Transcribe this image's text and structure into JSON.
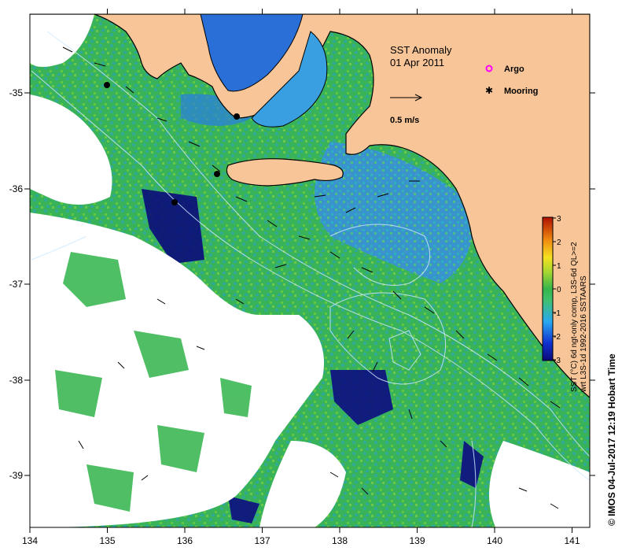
{
  "title": {
    "line1": "SST Anomaly",
    "line2": "01 Apr 2011"
  },
  "legend": {
    "argo_label": "Argo",
    "mooring_label": "Mooring",
    "argo_color": "#ff00ff",
    "mooring_color": "#000000",
    "argo_icon": "circle-marker",
    "mooring_icon": "star-marker"
  },
  "velocity_scale": {
    "label": "0.5 m/s",
    "icon": "arrow-right"
  },
  "axes": {
    "x_ticks": [
      "134",
      "135",
      "136",
      "137",
      "138",
      "139",
      "140",
      "141"
    ],
    "y_ticks": [
      "-35",
      "-36",
      "-37",
      "-38",
      "-39"
    ],
    "x_range": [
      134,
      141.3
    ],
    "y_range": [
      -39.45,
      -34.1
    ]
  },
  "colorbar": {
    "ticks": [
      "3",
      "2",
      "1",
      "0",
      "-1",
      "-2",
      "-3"
    ],
    "range": [
      -3,
      3
    ],
    "caption_line1": "SST (°C) 6d ngt-only comp, L3S-6d QL>=2",
    "caption_line2": "wrt L3S-1d 1992-2016 SSTAARS"
  },
  "footer": {
    "credit": "© IMOS 04-Jul-2017 12:19 Hobart Time"
  },
  "colors": {
    "land": "#f7c597",
    "ocean_base": "#3fb95b",
    "cold_anomaly": "#1a4fd6",
    "no_data": "#ffffff"
  },
  "moorings": [
    {
      "lon": 134.95,
      "lat": -34.95
    },
    {
      "lon": 136.65,
      "lat": -35.25
    },
    {
      "lon": 136.4,
      "lat": -35.85
    },
    {
      "lon": 135.85,
      "lat": -36.15
    }
  ]
}
